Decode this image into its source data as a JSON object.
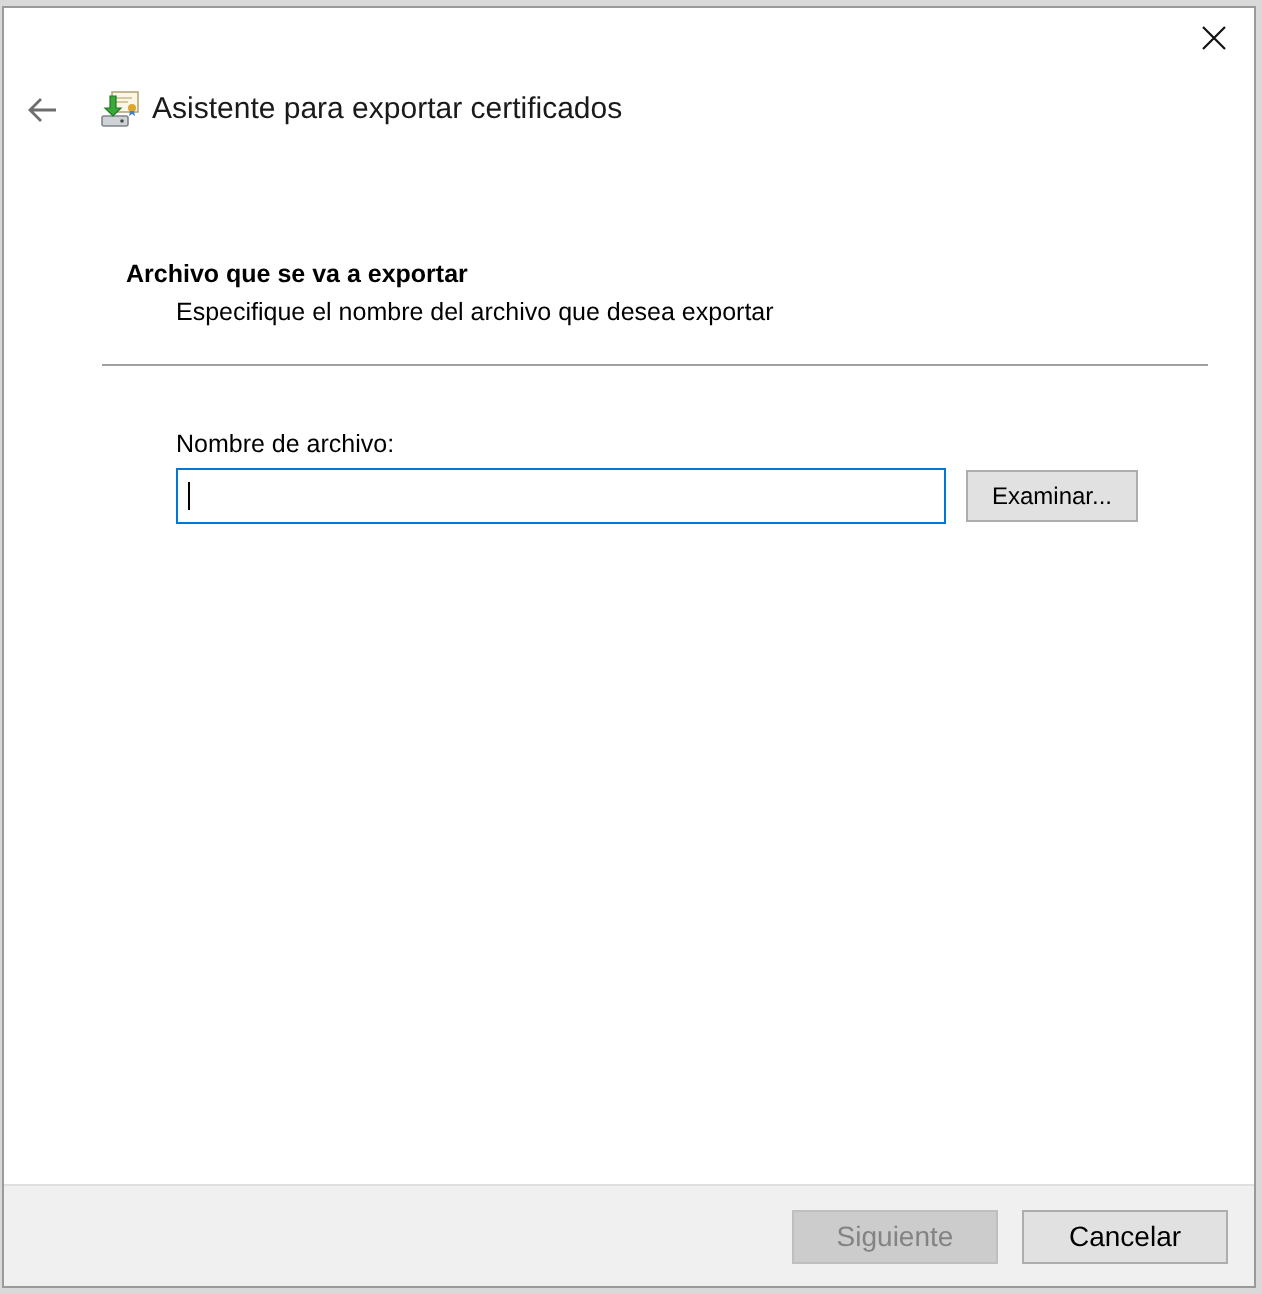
{
  "window": {
    "title": "Asistente para exportar certificados"
  },
  "header": {
    "title": "Archivo que se va a exportar",
    "subtitle": "Especifique el nombre del archivo que desea exportar"
  },
  "file_name": {
    "label": "Nombre de archivo:",
    "focused": true
  },
  "browse_button": {
    "label": "Examinar..."
  },
  "buttons": [
    {
      "label": "Siguiente",
      "disabled": true
    },
    {
      "label": "Cancelar",
      "disabled": false
    }
  ]
}
